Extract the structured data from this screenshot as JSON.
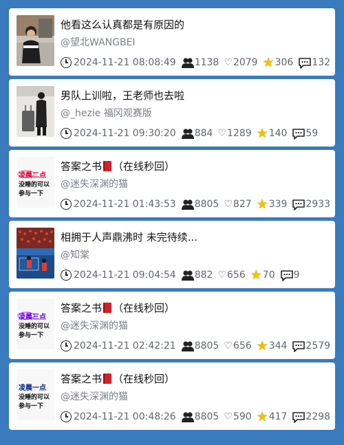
{
  "items": [
    {
      "title": "他看这么认真都是有原因的",
      "author": "@望北WANGBEI",
      "time": "2024-11-21 08:08:49",
      "users": "1138",
      "likes": "2079",
      "stars": "306",
      "comments": "132",
      "thumb_text": ""
    },
    {
      "title": "男队上训啦，王老师也去啦",
      "author": "@_hezie 福冈观赛版",
      "time": "2024-11-21 09:30:20",
      "users": "884",
      "likes": "1289",
      "stars": "140",
      "comments": "59",
      "thumb_text": ""
    },
    {
      "title_pre": "答案之书",
      "title_post": "（在线秒回）",
      "author": "@迷失深渊的猫",
      "time": "2024-11-21 01:43:53",
      "users": "8805",
      "likes": "827",
      "stars": "339",
      "comments": "2933",
      "thumb_text": [
        "凌晨二点",
        "没睡的可以",
        "参与一下"
      ]
    },
    {
      "title": "相拥于人声鼎沸时 未完待续...",
      "author": "@知棠",
      "time": "2024-11-21 09:04:54",
      "users": "882",
      "likes": "656",
      "stars": "70",
      "comments": "9",
      "thumb_text": ""
    },
    {
      "title_pre": "答案之书",
      "title_post": "（在线秒回）",
      "author": "@迷失深渊的猫",
      "time": "2024-11-21 02:42:21",
      "users": "8805",
      "likes": "656",
      "stars": "344",
      "comments": "2579",
      "thumb_text": [
        "凌晨三点",
        "没睡的可以",
        "参与一下"
      ]
    },
    {
      "title_pre": "答案之书",
      "title_post": "（在线秒回）",
      "author": "@迷失深渊的猫",
      "time": "2024-11-21 00:48:26",
      "users": "8805",
      "likes": "590",
      "stars": "417",
      "comments": "2298",
      "thumb_text": [
        "凌晨一点",
        "没睡的可以",
        "参与一下"
      ]
    }
  ]
}
